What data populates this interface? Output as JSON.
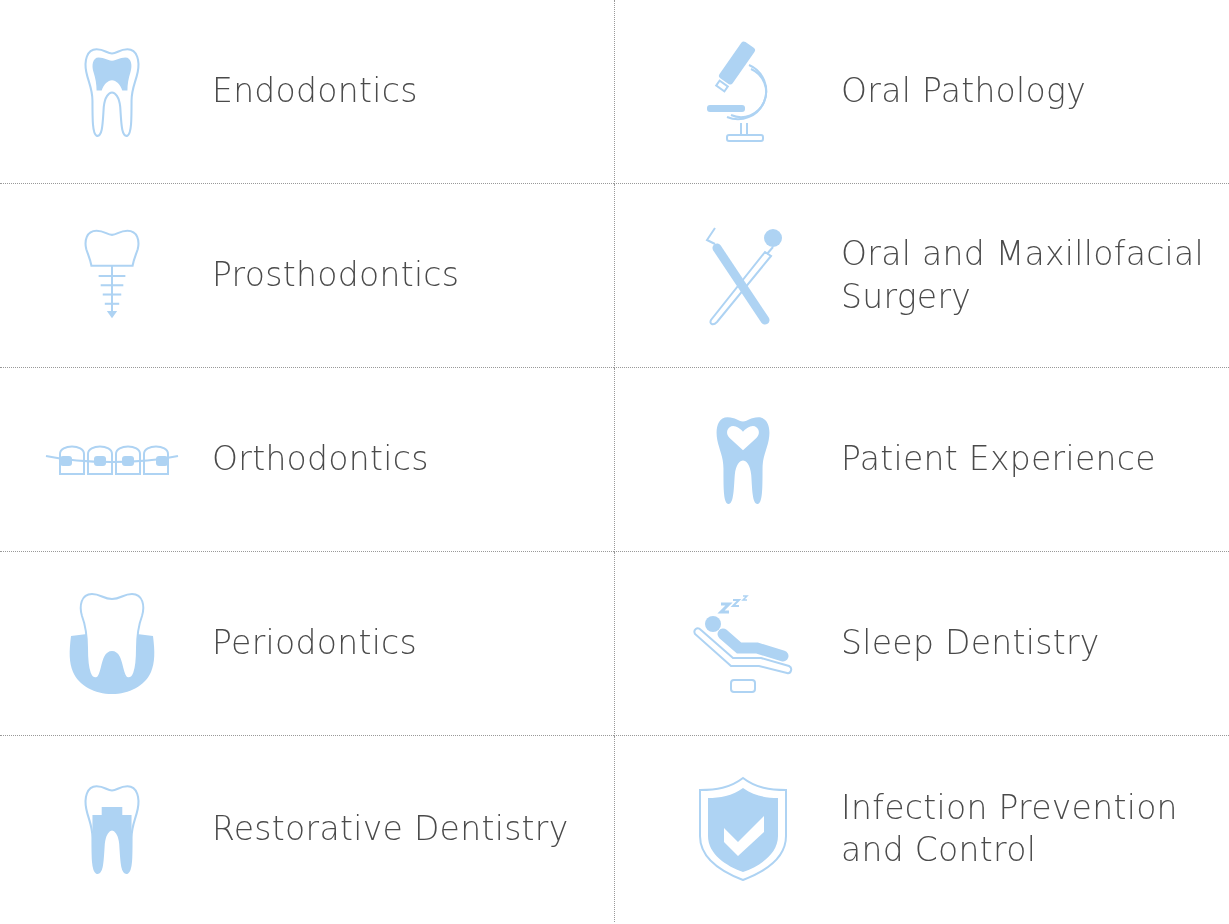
{
  "rows": [
    {
      "left": {
        "kind": "endodontics",
        "label": "Endodontics"
      },
      "right": {
        "kind": "pathology",
        "label": "Oral Pathology"
      }
    },
    {
      "left": {
        "kind": "implant",
        "label": "Prosthodontics"
      },
      "right": {
        "kind": "surgery",
        "label": "Oral and Maxillofacial Surgery"
      }
    },
    {
      "left": {
        "kind": "braces",
        "label": "Orthodontics"
      },
      "right": {
        "kind": "heart-tooth",
        "label": "Patient Experience"
      }
    },
    {
      "left": {
        "kind": "gums",
        "label": "Periodontics"
      },
      "right": {
        "kind": "sleep",
        "label": "Sleep Dentistry"
      }
    },
    {
      "left": {
        "kind": "filling",
        "label": "Restorative Dentistry"
      },
      "right": {
        "kind": "shield",
        "label": "Infection Prevention and Control"
      }
    }
  ]
}
